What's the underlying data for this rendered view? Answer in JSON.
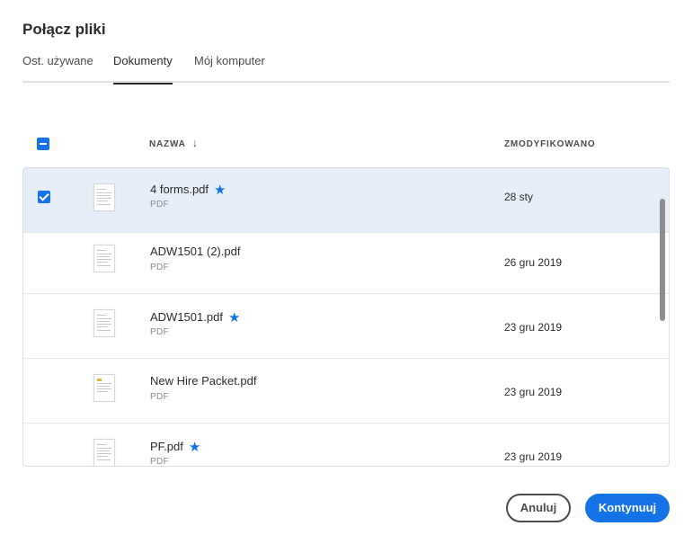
{
  "dialog": {
    "title": "Połącz pliki"
  },
  "tabs": [
    {
      "label": "Ost. używane",
      "active": false
    },
    {
      "label": "Dokumenty",
      "active": true
    },
    {
      "label": "Mój komputer",
      "active": false
    }
  ],
  "table": {
    "columns": {
      "name": "NAZWA",
      "name_sort": "↓",
      "modified": "ZMODYFIKOWANO"
    },
    "header_checkbox_state": "indeterminate",
    "files": [
      {
        "name": "4 forms.pdf",
        "type": "PDF",
        "modified": "28 sty",
        "starred": true,
        "selected": true
      },
      {
        "name": "ADW1501 (2).pdf",
        "type": "PDF",
        "modified": "26 gru 2019",
        "starred": false,
        "selected": false
      },
      {
        "name": "ADW1501.pdf",
        "type": "PDF",
        "modified": "23 gru 2019",
        "starred": true,
        "selected": false
      },
      {
        "name": "New Hire Packet.pdf",
        "type": "PDF",
        "modified": "23 gru 2019",
        "starred": false,
        "selected": false
      },
      {
        "name": "PF.pdf",
        "type": "PDF",
        "modified": "23 gru 2019",
        "starred": true,
        "selected": false
      }
    ]
  },
  "buttons": {
    "cancel": "Anuluj",
    "continue": "Kontynuuj"
  },
  "icons": {
    "star": "★"
  },
  "colors": {
    "accent": "#1473e6",
    "selected_row": "#e6eff9"
  }
}
